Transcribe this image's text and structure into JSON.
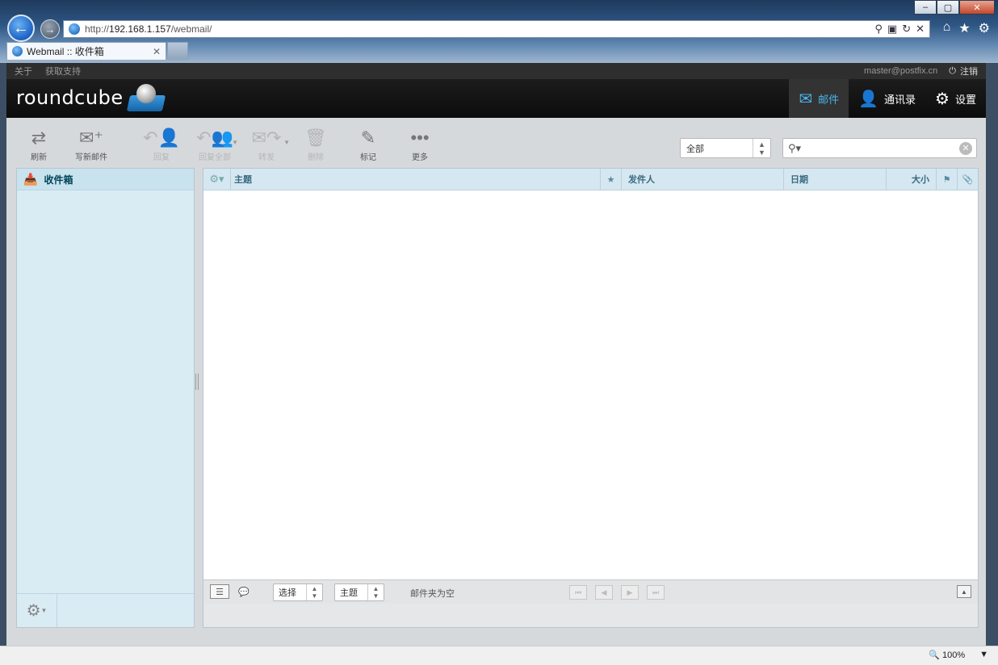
{
  "browser": {
    "url_prefix": "http://",
    "url_host": "192.168.1.157",
    "url_path": "/webmail/",
    "tab_title": "Webmail :: 收件箱",
    "win_min": "‒",
    "win_max": "▢",
    "win_close": "✕",
    "zoom": "100%"
  },
  "topline": {
    "about": "关于",
    "support": "获取支持",
    "user": "master@postfix.cn",
    "logout": "注销"
  },
  "header": {
    "logo": "roundcube",
    "tasks": [
      {
        "label": "邮件",
        "icon": "mail-icon"
      },
      {
        "label": "通讯录",
        "icon": "contacts-icon"
      },
      {
        "label": "设置",
        "icon": "settings-icon"
      }
    ]
  },
  "toolbar": {
    "refresh": "刷新",
    "compose": "写新邮件",
    "reply": "回复",
    "reply_all": "回复全部",
    "forward": "转发",
    "delete": "删除",
    "mark": "标记",
    "more": "更多"
  },
  "filter": {
    "selected": "全部"
  },
  "search": {
    "value": "",
    "placeholder": ""
  },
  "folders": {
    "items": [
      {
        "label": "收件箱"
      }
    ]
  },
  "list": {
    "columns": {
      "subject": "主题",
      "from": "发件人",
      "date": "日期",
      "size": "大小"
    },
    "footer": {
      "select": "选择",
      "threads": "主题",
      "count": "邮件夹为空"
    }
  },
  "colors": {
    "accent": "#4ab3e8",
    "header_bg": "#111111",
    "folder_bg": "#d9ecf4",
    "list_header": "#d5e7f0"
  }
}
